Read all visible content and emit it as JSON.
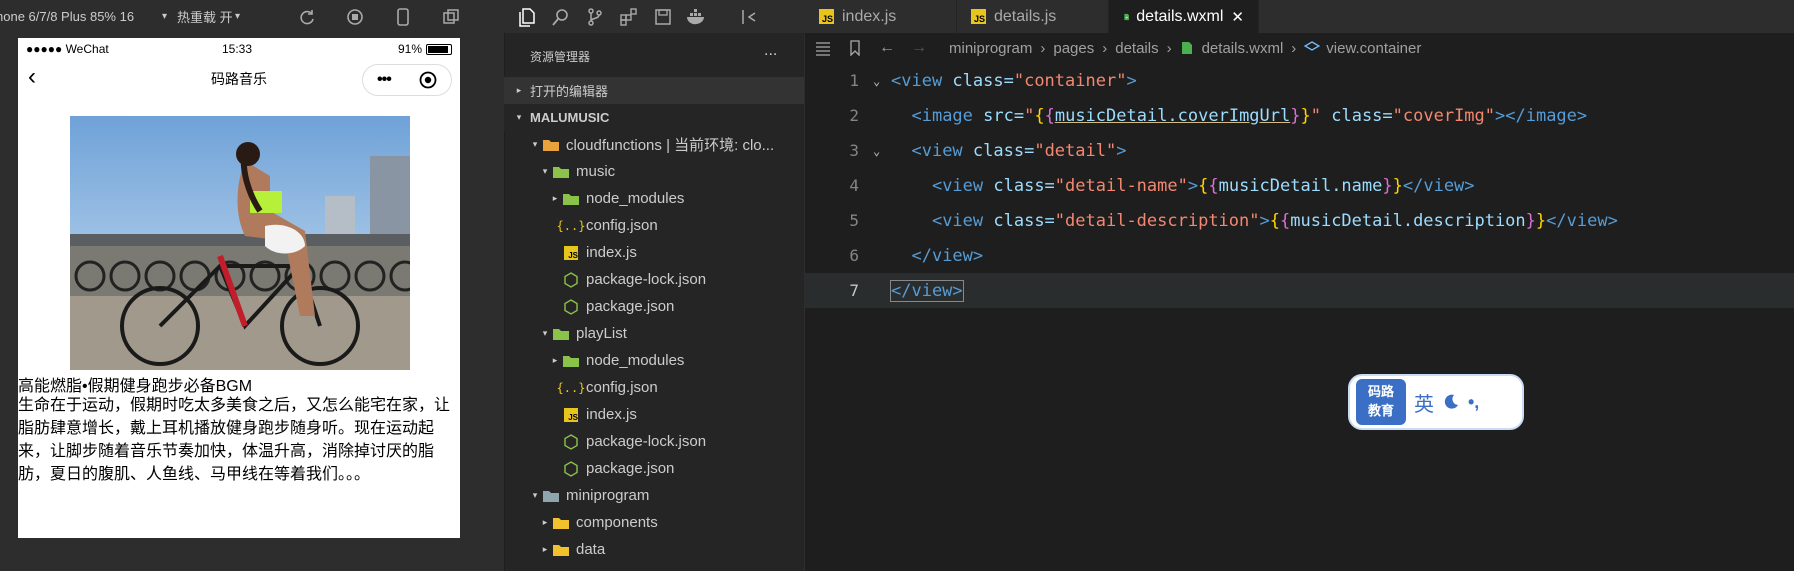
{
  "simulator": {
    "device": "hone 6/7/8 Plus 85% 16",
    "hot_reload": "热重载 开",
    "status": {
      "carrier": "●●●●● WeChat",
      "time": "15:33",
      "battery": "91%"
    },
    "battery_level": 0.91,
    "nav_title": "码路音乐",
    "music_name": "高能燃脂•假期健身跑步必备BGM",
    "music_description": "生命在于运动，假期时吃太多美食之后，又怎么能宅在家，让脂肪肆意增长，戴上耳机播放健身跑步随身听。现在运动起来，让脚步随着音乐节奏加快，体温升高，消除掉讨厌的脂肪，夏日的腹肌、人鱼线、马甲线在等着我们。。。"
  },
  "explorer": {
    "title": "资源管理器",
    "more": "...",
    "open_editors": "打开的编辑器",
    "project": "MALUMUSIC",
    "tree": [
      {
        "label": "cloudfunctions | 当前环境: clo...",
        "depth": 1,
        "arrow": "▾",
        "icon": "folder-cloud-icon"
      },
      {
        "label": "music",
        "depth": 2,
        "arrow": "▾",
        "icon": "folder-green-icon"
      },
      {
        "label": "node_modules",
        "depth": 3,
        "arrow": "▸",
        "icon": "folder-green-icon"
      },
      {
        "label": "config.json",
        "depth": 3,
        "arrow": "",
        "icon": "json-icon"
      },
      {
        "label": "index.js",
        "depth": 3,
        "arrow": "",
        "icon": "js-file-icon"
      },
      {
        "label": "package-lock.json",
        "depth": 3,
        "arrow": "",
        "icon": "package-icon"
      },
      {
        "label": "package.json",
        "depth": 3,
        "arrow": "",
        "icon": "package-icon"
      },
      {
        "label": "playList",
        "depth": 2,
        "arrow": "▾",
        "icon": "folder-green-icon"
      },
      {
        "label": "node_modules",
        "depth": 3,
        "arrow": "▸",
        "icon": "folder-green-icon"
      },
      {
        "label": "config.json",
        "depth": 3,
        "arrow": "",
        "icon": "json-icon"
      },
      {
        "label": "index.js",
        "depth": 3,
        "arrow": "",
        "icon": "js-file-icon"
      },
      {
        "label": "package-lock.json",
        "depth": 3,
        "arrow": "",
        "icon": "package-icon"
      },
      {
        "label": "package.json",
        "depth": 3,
        "arrow": "",
        "icon": "package-icon"
      },
      {
        "label": "miniprogram",
        "depth": 1,
        "arrow": "▾",
        "icon": "folder-blue-icon"
      },
      {
        "label": "components",
        "depth": 2,
        "arrow": "▸",
        "icon": "folder-yellow-icon"
      },
      {
        "label": "data",
        "depth": 2,
        "arrow": "▸",
        "icon": "folder-yellow-icon"
      }
    ]
  },
  "tabs": [
    {
      "label": "index.js",
      "type": "js"
    },
    {
      "label": "details.js",
      "type": "js"
    },
    {
      "label": "details.wxml",
      "type": "wxml",
      "active": true,
      "close": "✕"
    }
  ],
  "breadcrumb": [
    "miniprogram",
    "pages",
    "details",
    "details.wxml",
    "view.container"
  ],
  "code": {
    "line_numbers": [
      "1",
      "2",
      "3",
      "4",
      "5",
      "6",
      "7"
    ],
    "l1": {
      "open": "<view ",
      "attr": "class=",
      "val": "\"container\"",
      "close": ">"
    },
    "l2": {
      "open": "<image ",
      "attr1": "src=",
      "q1": "\"",
      "expr": "musicDetail.coverImgUrl",
      "q2": "\"",
      "attr2": " class=",
      "val2": "\"coverImg\"",
      "close": "></image>"
    },
    "l3": {
      "open": "<view ",
      "attr": "class=",
      "val": "\"detail\"",
      "close": ">"
    },
    "l4": {
      "open": "<view ",
      "attr": "class=",
      "val": "\"detail-name\"",
      "gt": ">",
      "expr": "musicDetail.name",
      "close": "</view>"
    },
    "l5": {
      "open": "<view ",
      "attr": "class=",
      "val": "\"detail-description\"",
      "gt": ">",
      "expr": "musicDetail.description",
      "close": "</view>"
    },
    "l6": {
      "close": "</view>"
    },
    "l7": {
      "close": "</view>"
    }
  },
  "ime": {
    "logo_line1": "码路",
    "logo_line2": "教育",
    "mode": "英",
    "punct": "•,"
  }
}
